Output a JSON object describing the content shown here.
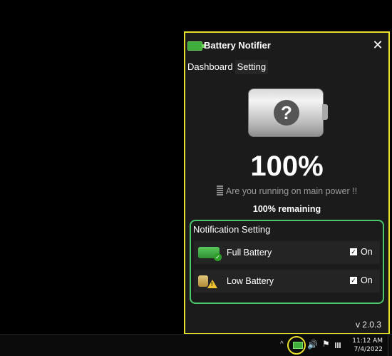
{
  "app": {
    "title": "Battery Notifier",
    "close_glyph": "✕"
  },
  "tabs": [
    {
      "label": "Dashboard",
      "active": false
    },
    {
      "label": "Setting",
      "active": true
    }
  ],
  "battery": {
    "icon": "question-mark-icon",
    "percent": "100%",
    "status": "Are you running on main power !!",
    "remaining": "100% remaining"
  },
  "notification": {
    "title": "Notification Setting",
    "rows": [
      {
        "label": "Full Battery",
        "checked": true,
        "state": "On"
      },
      {
        "label": "Low Battery",
        "checked": true,
        "state": "On"
      }
    ]
  },
  "version": "v 2.0.3",
  "taskbar": {
    "time": "11:12 AM",
    "date": "7/4/2022"
  },
  "colors": {
    "highlight": "#e8e02a",
    "accent": "#49c86a",
    "battery": "#3fae3a"
  }
}
